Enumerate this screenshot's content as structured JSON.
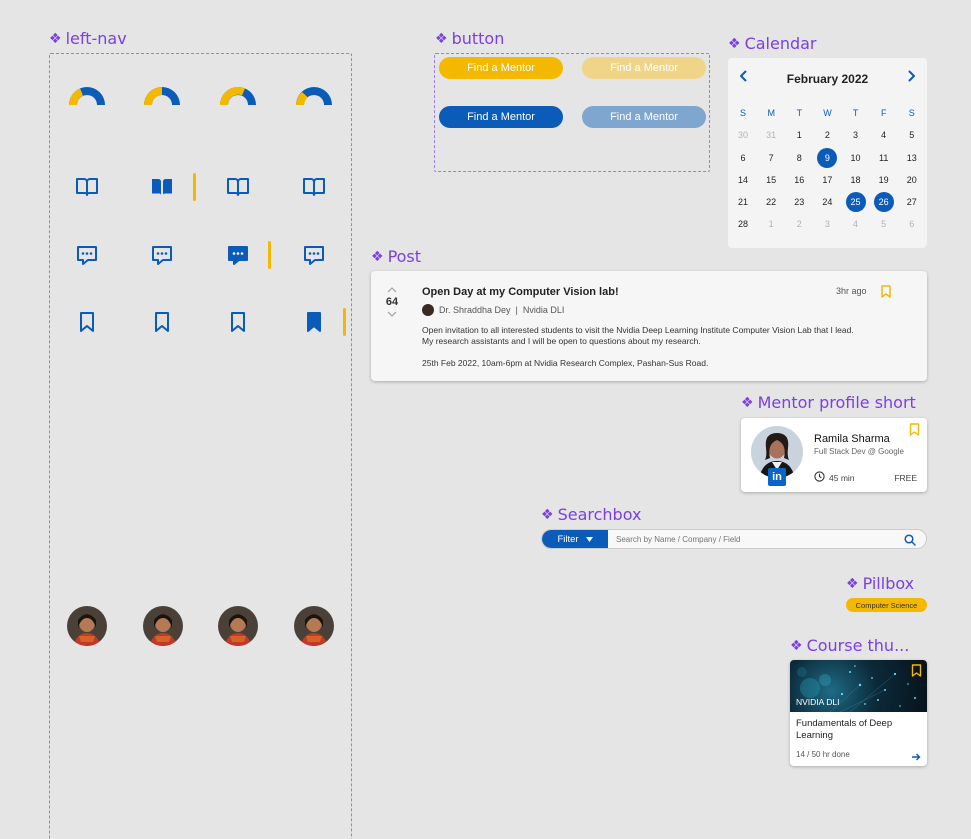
{
  "labels": {
    "left_nav": "left-nav",
    "button": "button",
    "calendar": "Calendar",
    "post": "Post",
    "mentor": "Mentor profile short",
    "searchbox": "Searchbox",
    "pillbox": "Pillbox",
    "course": "Course thu..."
  },
  "buttons": {
    "primary_yellow": "Find a Mentor",
    "disabled_yellow": "Find a Mentor",
    "primary_blue": "Find a Mentor",
    "disabled_blue": "Find a Mentor"
  },
  "calendar": {
    "month": "February 2022",
    "prev_icon": "chevron-left-icon",
    "next_icon": "chevron-right-icon",
    "weekdays": [
      "S",
      "M",
      "T",
      "W",
      "T",
      "F",
      "S"
    ],
    "days": [
      {
        "d": "30",
        "muted": true
      },
      {
        "d": "31",
        "muted": true
      },
      {
        "d": "1"
      },
      {
        "d": "2"
      },
      {
        "d": "3"
      },
      {
        "d": "4"
      },
      {
        "d": "5"
      },
      {
        "d": "6"
      },
      {
        "d": "7"
      },
      {
        "d": "8"
      },
      {
        "d": "9",
        "selected": true
      },
      {
        "d": "10"
      },
      {
        "d": "11"
      },
      {
        "d": "13"
      },
      {
        "d": "14"
      },
      {
        "d": "15"
      },
      {
        "d": "16"
      },
      {
        "d": "17"
      },
      {
        "d": "18"
      },
      {
        "d": "19"
      },
      {
        "d": "20"
      },
      {
        "d": "21"
      },
      {
        "d": "22"
      },
      {
        "d": "23"
      },
      {
        "d": "24"
      },
      {
        "d": "25",
        "selected": true
      },
      {
        "d": "26",
        "selected": true
      },
      {
        "d": "27"
      },
      {
        "d": "28"
      },
      {
        "d": "1",
        "muted": true
      },
      {
        "d": "2",
        "muted": true
      },
      {
        "d": "3",
        "muted": true
      },
      {
        "d": "4",
        "muted": true
      },
      {
        "d": "5",
        "muted": true
      },
      {
        "d": "6",
        "muted": true
      }
    ],
    "accent": "#0a5cb8"
  },
  "post": {
    "votes": "64",
    "title": "Open Day at my Computer Vision lab!",
    "author": "Dr. Shraddha Dey",
    "org": "Nvidia DLI",
    "separator": "|",
    "time": "3hr ago",
    "body_line1": "Open invitation to all interested students to visit the Nvidia Deep Learning Institute Computer Vision Lab that I lead.",
    "body_line2": "My research assistants and I will be open to questions about my research.",
    "details": "25th Feb 2022, 10am-6pm at Nvidia Research Complex, Pashan-Sus Road."
  },
  "mentor": {
    "name": "Ramila Sharma",
    "role": "Full Stack Dev @ Google",
    "duration": "45 min",
    "price": "FREE",
    "linkedin": "in"
  },
  "search": {
    "filter_label": "Filter",
    "placeholder": "Search by Name / Company / Field"
  },
  "pill": {
    "label": "Computer Science"
  },
  "course": {
    "org": "NVIDIA DLI",
    "title": "Fundamentals of Deep Learning",
    "progress": "14 / 50 hr done"
  },
  "colors": {
    "brand_blue": "#0a5cb8",
    "brand_yellow": "#f5b800",
    "label_purple": "#7b3fe4"
  }
}
